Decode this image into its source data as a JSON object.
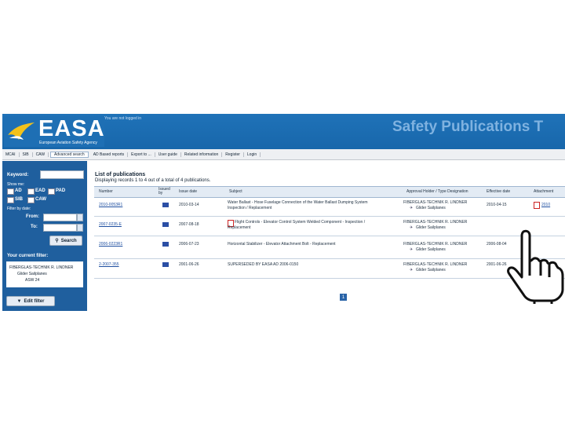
{
  "banner": {
    "logo_text": "EASA",
    "logo_subtitle": "European Aviation Safety Agency",
    "logged_in": "You are not logged in",
    "title": "Safety Publications T"
  },
  "menu": [
    "MCAI",
    "SIB",
    "CAW",
    "Advanced search",
    "AD Based reports",
    "Export to ...",
    "User guide",
    "Related information",
    "Register",
    "Login"
  ],
  "search": {
    "keyword_label": "Keyword:",
    "show_label": "Show me:",
    "types": [
      "AD",
      "EAD",
      "PAD",
      "SIB",
      "CAW"
    ],
    "filter_dates_label": "Filter by date:",
    "from_label": "From:",
    "to_label": "To:",
    "search_button": "Search",
    "current_filter_label": "Your current filter:",
    "filter_items": [
      "FIBERGLAS-TECHNIK R. LINDNER",
      "Glider Sailplanes",
      "ASW 24"
    ],
    "edit_filter_button": "Edit filter"
  },
  "list": {
    "title": "List of publications",
    "subtitle": "Displaying records 1 to 4 out of a total of 4 publications.",
    "columns": [
      "Number",
      "Issued by",
      "Issue date",
      "Subject",
      "Approval Holder / Type Designation",
      "Effective date",
      "Attachment"
    ],
    "rows": [
      {
        "number": "2010-0053R1",
        "date": "2010-03-14",
        "subject_line1": "Water Ballast - Hose Fuselage Connection of the Water Ballast Dumping System",
        "subject_line2": "Inspection / Replacement",
        "holder": "FIBERGLAS-TECHNIK R. LINDNER",
        "type": "Glider Sailplanes",
        "effective": "2010-04-15",
        "attachment": "2010"
      },
      {
        "number": "2007-0235-E",
        "date": "2007-08-18",
        "subject_line1": "Flight Controls - Elevator Control System Welded Component - Inspection /",
        "subject_line2": "Replacement",
        "holder": "FIBERGLAS-TECHNIK R. LINDNER",
        "type": "Glider Sailplanes",
        "effective": "",
        "attachment": ""
      },
      {
        "number": "2006-0223R1",
        "date": "2006-07-23",
        "subject_line1": "Horizontal Stabilizer - Elevator Attachment Bolt - Replacement",
        "subject_line2": "",
        "holder": "FIBERGLAS-TECHNIK R. LINDNER",
        "type": "Glider Sailplanes",
        "effective": "2006-08-04",
        "attachment": ""
      },
      {
        "number": "2-2007-355",
        "date": "2001-06-26",
        "subject_line1": "SUPERSEDED BY EASA AD 2006-0150",
        "subject_line2": "",
        "holder": "FIBERGLAS-TECHNIK R. LINDNER",
        "type": "Glider Sailplanes",
        "effective": "2001-06-26",
        "attachment": "2001b"
      }
    ],
    "page": "1"
  },
  "colors": {
    "banner": "#1f72b8",
    "sidebar": "#1f5f9e",
    "header": "#e3ebf4"
  }
}
